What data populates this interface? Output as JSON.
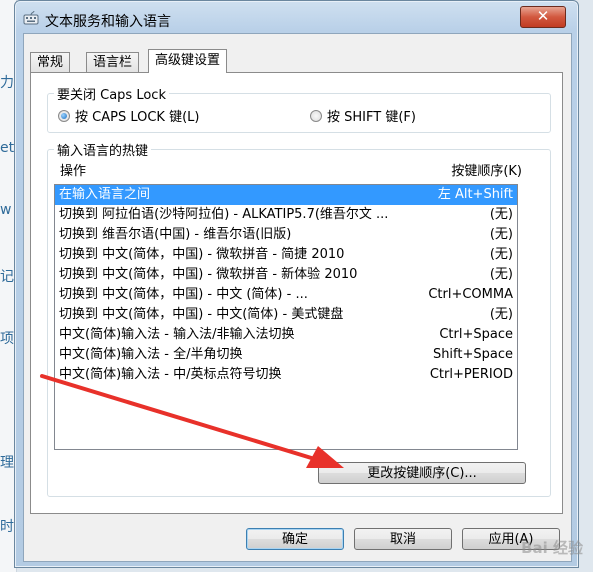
{
  "window": {
    "title": "文本服务和输入语言",
    "close_symbol": "✕"
  },
  "tabs": [
    {
      "label": "常规",
      "active": false
    },
    {
      "label": "语言栏",
      "active": false
    },
    {
      "label": "高级键设置",
      "active": true
    }
  ],
  "caps_lock": {
    "legend": "要关闭 Caps Lock",
    "options": [
      {
        "label": "按 CAPS LOCK 键(L)",
        "checked": true
      },
      {
        "label": "按 SHIFT 键(F)",
        "checked": false
      }
    ]
  },
  "hotkeys": {
    "legend": "输入语言的热键",
    "col_action": "操作",
    "col_key": "按键顺序(K)",
    "rows": [
      {
        "action": "在输入语言之间",
        "key": "左 Alt+Shift",
        "selected": true
      },
      {
        "action": "切换到 阿拉伯语(沙特阿拉伯) - ALKATIP5.7(维吾尔文 ...",
        "key": "(无)",
        "selected": false
      },
      {
        "action": "切换到 维吾尔语(中国) - 维吾尔语(旧版)",
        "key": "(无)",
        "selected": false
      },
      {
        "action": "切换到 中文(简体，中国) - 微软拼音 - 简捷 2010",
        "key": "(无)",
        "selected": false
      },
      {
        "action": "切换到 中文(简体，中国) - 微软拼音 - 新体验 2010",
        "key": "(无)",
        "selected": false
      },
      {
        "action": "切换到 中文(简体，中国) - 中文 (简体) - ...",
        "key": "Ctrl+COMMA",
        "selected": false
      },
      {
        "action": "切换到 中文(简体，中国) - 中文(简体) - 美式键盘",
        "key": "(无)",
        "selected": false
      },
      {
        "action": "中文(简体)输入法 - 输入法/非输入法切换",
        "key": "Ctrl+Space",
        "selected": false
      },
      {
        "action": "中文(简体)输入法 - 全/半角切换",
        "key": "Shift+Space",
        "selected": false
      },
      {
        "action": "中文(简体)输入法 - 中/英标点符号切换",
        "key": "Ctrl+PERIOD",
        "selected": false
      }
    ],
    "change_button": "更改按键顺序(C)..."
  },
  "footer": {
    "ok": "确定",
    "cancel": "取消",
    "apply": "应用(A)"
  },
  "background_chars": [
    "力",
    "et",
    "w",
    "记",
    "项",
    "理",
    "时"
  ],
  "colors": {
    "selection": "#3399ff",
    "annotation_arrow": "#e8312a",
    "title_bar": "#b9d0e8"
  },
  "icons": {
    "title": "keyboard-icon",
    "close": "close-icon"
  },
  "watermark": "Bai 经验"
}
